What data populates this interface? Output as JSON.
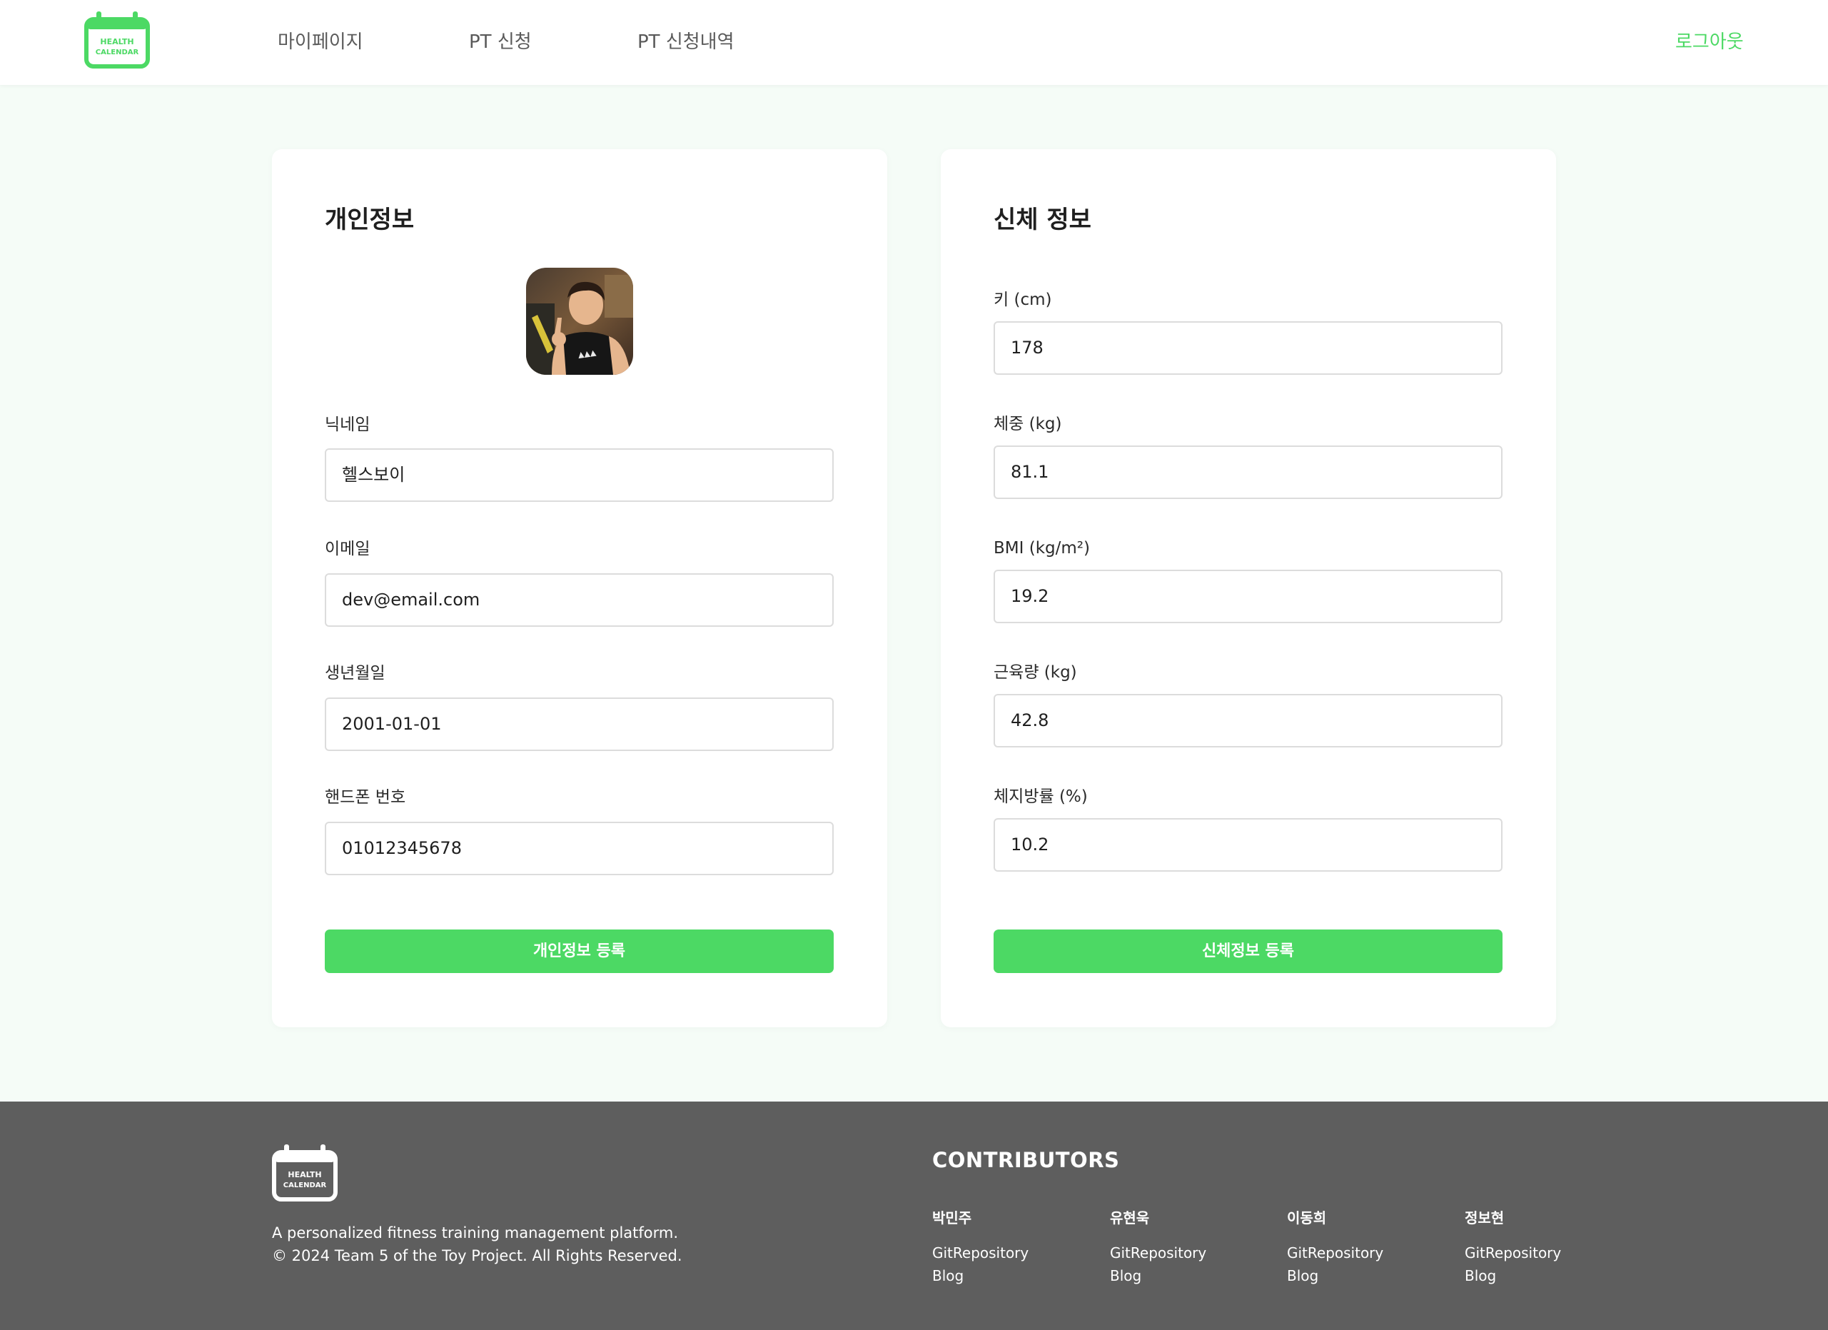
{
  "header": {
    "logo_text_1": "HEALTH",
    "logo_text_2": "CALENDAR",
    "nav": [
      "마이페이지",
      "PT 신청",
      "PT 신청내역"
    ],
    "logout": "로그아웃"
  },
  "personal": {
    "title": "개인정보",
    "nickname_label": "닉네임",
    "nickname_value": "헬스보이",
    "email_label": "이메일",
    "email_value": "dev@email.com",
    "birth_label": "생년월일",
    "birth_value": "2001-01-01",
    "phone_label": "핸드폰 번호",
    "phone_value": "01012345678",
    "submit_label": "개인정보 등록"
  },
  "body_info": {
    "title": "신체 정보",
    "height_label": "키 (cm)",
    "height_value": "178",
    "weight_label": "체중 (kg)",
    "weight_value": "81.1",
    "bmi_label": "BMI (kg/m²)",
    "bmi_value": "19.2",
    "muscle_label": "근육량 (kg)",
    "muscle_value": "42.8",
    "fat_label": "체지방률 (%)",
    "fat_value": "10.2",
    "submit_label": "신체정보 등록"
  },
  "footer": {
    "description": "A personalized fitness training management platform.",
    "copyright": "© 2024 Team 5 of the Toy Project. All Rights Reserved.",
    "contributors_title": "CONTRIBUTORS",
    "contributors": [
      {
        "name": "박민주",
        "git": "GitRepository",
        "blog": "Blog"
      },
      {
        "name": "유현욱",
        "git": "GitRepository",
        "blog": "Blog"
      },
      {
        "name": "이동희",
        "git": "GitRepository",
        "blog": "Blog"
      },
      {
        "name": "정보현",
        "git": "GitRepository",
        "blog": "Blog"
      }
    ]
  },
  "colors": {
    "accent": "#4cd964",
    "page_bg": "#f5fcf7",
    "footer_bg": "#5e5e5e"
  }
}
